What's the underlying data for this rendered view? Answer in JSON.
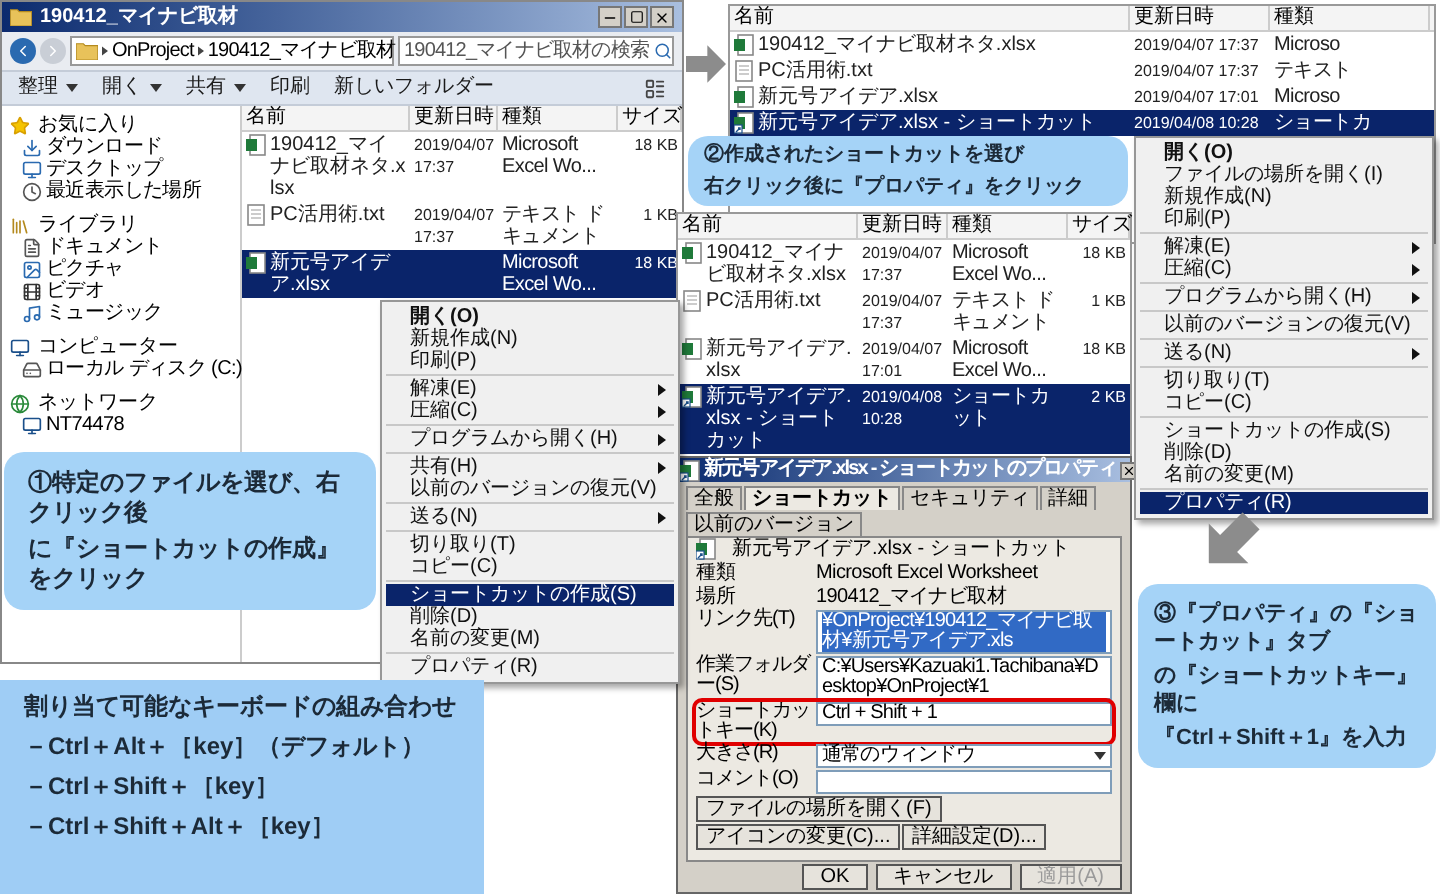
{
  "explorer_main": {
    "title": "190412_マイナビ取材",
    "breadcrumb": [
      "OnProject",
      "190412_マイナビ取材"
    ],
    "search": {
      "placeholder": "190412_マイナビ取材の検索"
    },
    "toolbar": [
      {
        "label": "整理",
        "dropdown": true
      },
      {
        "label": "開く",
        "dropdown": true
      },
      {
        "label": "共有",
        "dropdown": true
      },
      {
        "label": "印刷",
        "dropdown": false
      },
      {
        "label": "新しいフォルダー",
        "dropdown": false
      }
    ],
    "nav": [
      {
        "label": "お気に入り",
        "kind": "favorites",
        "children": [
          {
            "label": "ダウンロード",
            "kind": "downloads"
          },
          {
            "label": "デスクトップ",
            "kind": "desktop"
          },
          {
            "label": "最近表示した場所",
            "kind": "recent"
          }
        ]
      },
      {
        "label": "ライブラリ",
        "kind": "library",
        "children": [
          {
            "label": "ドキュメント",
            "kind": "documents"
          },
          {
            "label": "ピクチャ",
            "kind": "pictures"
          },
          {
            "label": "ビデオ",
            "kind": "videos"
          },
          {
            "label": "ミュージック",
            "kind": "music"
          }
        ]
      },
      {
        "label": "コンピューター",
        "kind": "computer",
        "children": [
          {
            "label": "ローカル ディスク (C:)",
            "kind": "disk"
          }
        ]
      },
      {
        "label": "ネットワーク",
        "kind": "network",
        "children": [
          {
            "label": "NT74478",
            "kind": "pc"
          }
        ]
      }
    ],
    "columns": [
      "名前",
      "更新日時",
      "種類",
      "サイズ"
    ],
    "files": [
      {
        "kind": "excel",
        "name": "190412_マイナビ取材ネタ.xlsx",
        "modified": "2019/04/07 17:37",
        "type": "Microsoft Excel Wo...",
        "size": "18 KB",
        "selected": false
      },
      {
        "kind": "text",
        "name": "PC活用術.txt",
        "modified": "2019/04/07 17:37",
        "type": "テキスト ドキュメント",
        "size": "1 KB",
        "selected": false
      },
      {
        "kind": "excel",
        "name": "新元号アイデア.xlsx",
        "type": "Microsoft Excel Wo...",
        "size": "18 KB",
        "selected": true
      }
    ],
    "context_menu": {
      "groups": [
        {
          "items": [
            {
              "label": "開く(O)",
              "bold": true,
              "submenu": false,
              "selected": false
            },
            {
              "label": "新規作成(N)",
              "bold": false,
              "submenu": false,
              "selected": false
            },
            {
              "label": "印刷(P)",
              "bold": false,
              "submenu": false,
              "selected": false
            }
          ]
        },
        {
          "items": [
            {
              "label": "解凍(E)",
              "bold": false,
              "submenu": true,
              "selected": false
            },
            {
              "label": "圧縮(C)",
              "bold": false,
              "submenu": true,
              "selected": false
            }
          ]
        },
        {
          "items": [
            {
              "label": "プログラムから開く(H)",
              "bold": false,
              "submenu": true,
              "selected": false
            }
          ]
        },
        {
          "items": [
            {
              "label": "共有(H)",
              "bold": false,
              "submenu": true,
              "selected": false
            },
            {
              "label": "以前のバージョンの復元(V)",
              "bold": false,
              "submenu": false,
              "selected": false
            }
          ]
        },
        {
          "items": [
            {
              "label": "送る(N)",
              "bold": false,
              "submenu": true,
              "selected": false
            }
          ]
        },
        {
          "items": [
            {
              "label": "切り取り(T)",
              "bold": false,
              "submenu": false,
              "selected": false
            },
            {
              "label": "コピー(C)",
              "bold": false,
              "submenu": false,
              "selected": false
            }
          ]
        },
        {
          "items": [
            {
              "label": "ショートカットの作成(S)",
              "bold": false,
              "submenu": false,
              "selected": true
            },
            {
              "label": "削除(D)",
              "bold": false,
              "submenu": false,
              "selected": false
            },
            {
              "label": "名前の変更(M)",
              "bold": false,
              "submenu": false,
              "selected": false
            }
          ]
        },
        {
          "items": [
            {
              "label": "プロパティ(R)",
              "bold": false,
              "submenu": false,
              "selected": false
            }
          ]
        }
      ]
    }
  },
  "explorer_shortcut": {
    "columns": [
      "名前",
      "更新日時",
      "種類"
    ],
    "files": [
      {
        "kind": "excel",
        "name": "190412_マイナビ取材ネタ.xlsx",
        "modified": "2019/04/07 17:37",
        "type": "Microso",
        "selected": false
      },
      {
        "kind": "text",
        "name": "PC活用術.txt",
        "modified": "2019/04/07 17:37",
        "type": "テキスト",
        "selected": false
      },
      {
        "kind": "excel",
        "name": "新元号アイデア.xlsx",
        "modified": "2019/04/07 17:01",
        "type": "Microso",
        "selected": false
      },
      {
        "kind": "shortcut",
        "name": "新元号アイデア.xlsx - ショートカット",
        "modified": "2019/04/08 10:28",
        "type": "ショートカ",
        "selected": true
      }
    ],
    "context_menu": {
      "groups": [
        {
          "items": [
            {
              "label": "開く(O)",
              "bold": true,
              "submenu": false,
              "selected": false
            },
            {
              "label": "ファイルの場所を開く(I)",
              "bold": false,
              "submenu": false,
              "selected": false
            },
            {
              "label": "新規作成(N)",
              "bold": false,
              "submenu": false,
              "selected": false
            },
            {
              "label": "印刷(P)",
              "bold": false,
              "submenu": false,
              "selected": false
            }
          ]
        },
        {
          "items": [
            {
              "label": "解凍(E)",
              "bold": false,
              "submenu": true,
              "selected": false
            },
            {
              "label": "圧縮(C)",
              "bold": false,
              "submenu": true,
              "selected": false
            }
          ]
        },
        {
          "items": [
            {
              "label": "プログラムから開く(H)",
              "bold": false,
              "submenu": true,
              "selected": false
            }
          ]
        },
        {
          "items": [
            {
              "label": "以前のバージョンの復元(V)",
              "bold": false,
              "submenu": false,
              "selected": false
            }
          ]
        },
        {
          "items": [
            {
              "label": "送る(N)",
              "bold": false,
              "submenu": true,
              "selected": false
            }
          ]
        },
        {
          "items": [
            {
              "label": "切り取り(T)",
              "bold": false,
              "submenu": false,
              "selected": false
            },
            {
              "label": "コピー(C)",
              "bold": false,
              "submenu": false,
              "selected": false
            }
          ]
        },
        {
          "items": [
            {
              "label": "ショートカットの作成(S)",
              "bold": false,
              "submenu": false,
              "selected": false
            },
            {
              "label": "削除(D)",
              "bold": false,
              "submenu": false,
              "selected": false
            },
            {
              "label": "名前の変更(M)",
              "bold": false,
              "submenu": false,
              "selected": false
            }
          ]
        },
        {
          "items": [
            {
              "label": "プロパティ(R)",
              "bold": false,
              "submenu": false,
              "selected": true
            }
          ]
        }
      ]
    }
  },
  "explorer_result": {
    "columns": [
      "名前",
      "更新日時",
      "種類",
      "サイズ"
    ],
    "files": [
      {
        "kind": "excel",
        "name": "190412_マイナビ取材ネタ.xlsx",
        "modified": "2019/04/07 17:37",
        "type": "Microsoft Excel Wo...",
        "size": "18 KB",
        "selected": false
      },
      {
        "kind": "text",
        "name": "PC活用術.txt",
        "modified": "2019/04/07 17:37",
        "type": "テキスト ドキュメント",
        "size": "1 KB",
        "selected": false
      },
      {
        "kind": "excel",
        "name": "新元号アイデア.xlsx",
        "modified": "2019/04/07 17:01",
        "type": "Microsoft Excel Wo...",
        "size": "18 KB",
        "selected": false
      },
      {
        "kind": "shortcut",
        "name": "新元号アイデア.xlsx - ショートカット",
        "modified": "2019/04/08 10:28",
        "type": "ショートカット",
        "size": "2 KB",
        "selected": true
      }
    ]
  },
  "dialog": {
    "title": "新元号アイデア.xlsx - ショートカットのプロパティ",
    "tabs": [
      {
        "label": "全般",
        "selected": false
      },
      {
        "label": "ショートカット",
        "selected": true
      },
      {
        "label": "セキュリティ",
        "selected": false
      },
      {
        "label": "詳細",
        "selected": false
      },
      {
        "label": "以前のバージョン",
        "selected": false
      }
    ],
    "name": "新元号アイデア.xlsx - ショートカット",
    "info": [
      {
        "label": "種類",
        "value": "Microsoft Excel Worksheet"
      },
      {
        "label": "場所",
        "value": "190412_マイナビ取材"
      }
    ],
    "fields": [
      {
        "kind": "text",
        "label": "リンク先(T)",
        "value": "¥OnProject¥190412_マイナビ取材¥新元号アイデア.xls",
        "selected": true,
        "highlighted": false
      },
      {
        "kind": "text",
        "label": "作業フォルダー(S)",
        "value": "C:¥Users¥Kazuaki1.Tachibana¥Desktop¥OnProject¥1",
        "selected": false,
        "highlighted": false
      },
      {
        "kind": "text",
        "label": "ショートカットキー(K)",
        "value": "Ctrl + Shift + 1",
        "selected": false,
        "highlighted": true
      },
      {
        "kind": "select",
        "label": "大きさ(R)",
        "value": "通常のウィンドウ",
        "selected": false,
        "highlighted": false
      },
      {
        "kind": "text",
        "label": "コメント(O)",
        "selected": false,
        "highlighted": false
      }
    ],
    "buttons": [
      "ファイルの場所を開く(F)",
      "アイコンの変更(C)...",
      "詳細設定(D)..."
    ],
    "footer_buttons": [
      {
        "label": "OK",
        "disabled": false
      },
      {
        "label": "キャンセル",
        "disabled": false
      },
      {
        "label": "適用(A)",
        "disabled": true
      }
    ]
  },
  "callouts": [
    {
      "lines": [
        "①特定のファイルを選び、右クリック後",
        "に『ショートカットの作成』をクリック"
      ]
    },
    {
      "lines": [
        "②作成されたショートカットを選び",
        "右クリック後に『プロパティ』をクリック"
      ]
    },
    {
      "lines": [
        "③『プロパティ』の『ショートカット』タブ",
        "の『ショートカットキー』欄に",
        "『Ctrl＋Shift＋1』を入力"
      ]
    }
  ],
  "key_combinations": {
    "title": "割り当て可能なキーボードの組み合わせ",
    "items": [
      "－Ctrl＋Alt＋［key］（デフォルト）",
      "－Ctrl＋Shift＋［key］",
      "－Ctrl＋Shift＋Alt＋［key］"
    ]
  }
}
